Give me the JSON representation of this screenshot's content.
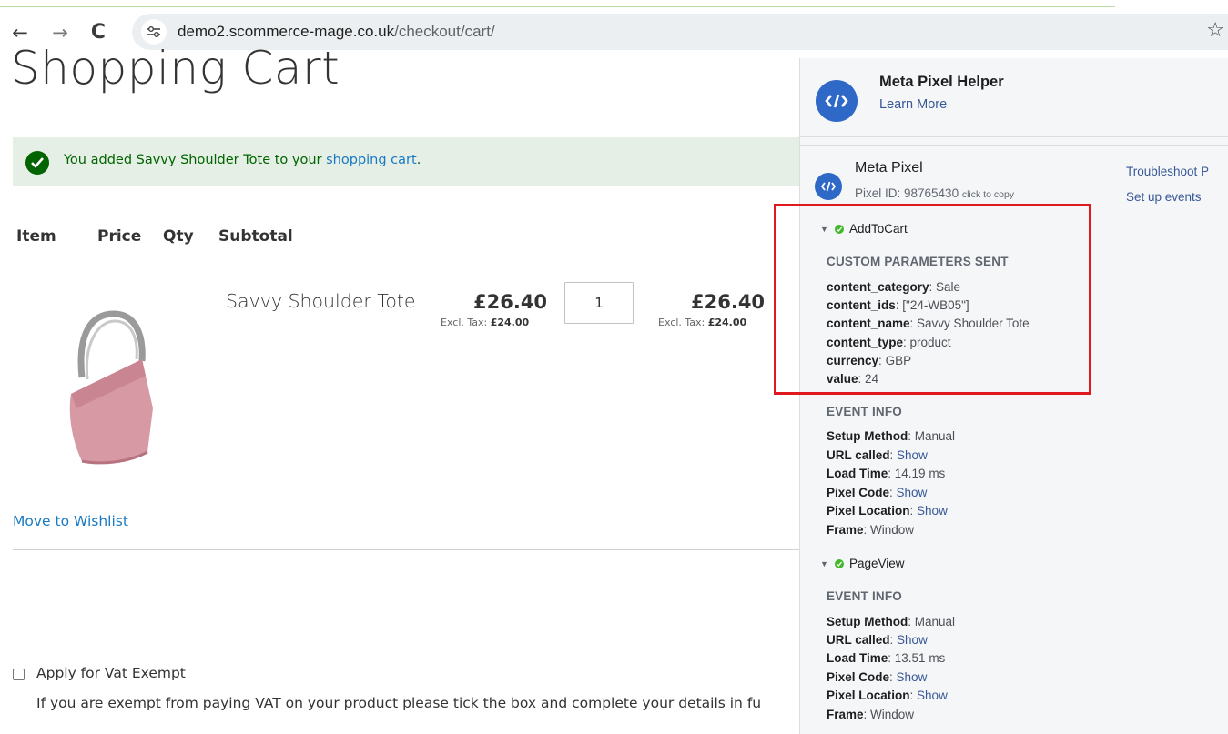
{
  "browser": {
    "url_domain": "demo2.scommerce-mage.co.uk",
    "url_path": "/checkout/cart/",
    "back_icon": "←",
    "forward_icon": "→",
    "reload_icon": "C",
    "bookmark_icon": "☆"
  },
  "page": {
    "title": "Shopping Cart",
    "alert": {
      "text_before": "You added Savvy Shoulder Tote to your ",
      "link": "shopping cart",
      "text_after": "."
    },
    "table_headers": [
      "Item",
      "Price",
      "Qty",
      "Subtotal"
    ],
    "cart_item": {
      "name": "Savvy Shoulder Tote",
      "price": "£26.40",
      "price_excl_label": "Excl. Tax: ",
      "price_excl_value": "£24.00",
      "qty": "1",
      "subtotal": "£26.40",
      "subtotal_excl_label": "Excl. Tax: ",
      "subtotal_excl_value": "£24.00",
      "image_color": "#d79aa4"
    },
    "move_to_wishlist": "Move to Wishlist",
    "vat": {
      "label": "Apply for Vat Exempt",
      "checked": false,
      "description": "If you are exempt from paying VAT on your product please tick the box and complete your details in fu"
    }
  },
  "extension": {
    "title": "Meta Pixel Helper",
    "learn_more": "Learn More",
    "pixel": {
      "name": "Meta Pixel",
      "id_label": "Pixel ID: 98765430",
      "copy_hint": "click to copy",
      "troubleshoot": "Troubleshoot P",
      "setup_events": "Set up events"
    },
    "events": [
      {
        "name": "AddToCart",
        "custom_title": "CUSTOM PARAMETERS SENT",
        "params": [
          {
            "key": "content_category",
            "value": "Sale"
          },
          {
            "key": "content_ids",
            "value": "[\"24-WB05\"]"
          },
          {
            "key": "content_name",
            "value": "Savvy Shoulder Tote"
          },
          {
            "key": "content_type",
            "value": "product"
          },
          {
            "key": "currency",
            "value": "GBP"
          },
          {
            "key": "value",
            "value": "24"
          }
        ],
        "info_title": "EVENT INFO",
        "info": [
          {
            "key": "Setup Method",
            "value": "Manual",
            "link": false
          },
          {
            "key": "URL called",
            "value": "Show",
            "link": true
          },
          {
            "key": "Load Time",
            "value": "14.19 ms",
            "link": false
          },
          {
            "key": "Pixel Code",
            "value": "Show",
            "link": true
          },
          {
            "key": "Pixel Location",
            "value": "Show",
            "link": true
          },
          {
            "key": "Frame",
            "value": "Window",
            "link": false
          }
        ]
      },
      {
        "name": "PageView",
        "info_title": "EVENT INFO",
        "info": [
          {
            "key": "Setup Method",
            "value": "Manual",
            "link": false
          },
          {
            "key": "URL called",
            "value": "Show",
            "link": true
          },
          {
            "key": "Load Time",
            "value": "13.51 ms",
            "link": false
          },
          {
            "key": "Pixel Code",
            "value": "Show",
            "link": true
          },
          {
            "key": "Pixel Location",
            "value": "Show",
            "link": true
          },
          {
            "key": "Frame",
            "value": "Window",
            "link": false
          }
        ]
      }
    ],
    "colors": {
      "brand_blue": "#2e69c8",
      "success_green": "#42b72a",
      "highlight_red": "#e0191f"
    }
  }
}
